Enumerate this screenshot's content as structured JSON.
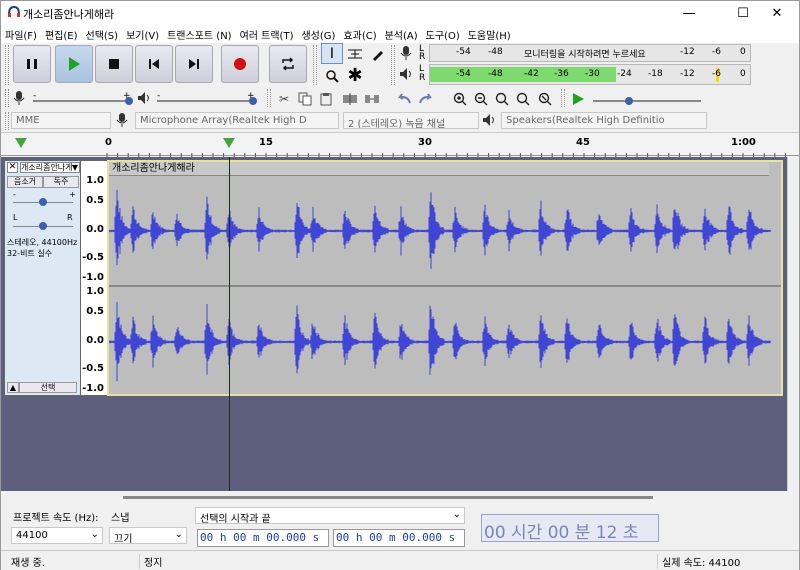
{
  "window": {
    "title": "개소리좀안나게해라",
    "minimize": "—",
    "maximize": "☐",
    "close": "✕"
  },
  "menu": [
    "파일(F)",
    "편집(E)",
    "선택(S)",
    "보기(V)",
    "트랜스포트 (N)",
    "여러 트랙(T)",
    "생성(G)",
    "효과(C)",
    "분석(A)",
    "도구(O)",
    "도움말(H)"
  ],
  "meters": {
    "record_ticks": [
      "-54",
      "-48",
      "모니터링을 시작하려면 누르세요",
      "-12",
      "-6",
      "0"
    ],
    "play_ticks": [
      "-54",
      "-48",
      "-42",
      "-36",
      "-30",
      "-24",
      "-18",
      "-12",
      "-6",
      "0"
    ],
    "channel_l": "L",
    "channel_r": "R",
    "play_level": 0.58
  },
  "devices": {
    "host": "MME",
    "input": "Microphone Array(Realtek High D",
    "channels": "2 (스테레오) 녹음 채널",
    "output": "Speakers(Realtek High Definitio"
  },
  "ruler": {
    "labels": [
      "0",
      "15",
      "30",
      "45",
      "1:00"
    ]
  },
  "track": {
    "name": "개소리좀안나게",
    "clip_name": "개소리좀안나게해라",
    "mute": "음소거",
    "solo": "독주",
    "gain_minus": "-",
    "gain_plus": "+",
    "pan_l": "L",
    "pan_r": "R",
    "info_line1": "스테레오, 44100Hz",
    "info_line2": "32-비트 실수",
    "select": "선택",
    "close": "✕",
    "collapse": "▲",
    "yticks": [
      "1.0",
      "0.5",
      "0.0",
      "-0.5",
      "-1.0"
    ]
  },
  "bottom": {
    "rate_label": "프로젝트 속도 (Hz):",
    "rate_value": "44100",
    "snap_label": "스냅",
    "snap_value": "끄기",
    "selection_label": "선택의 시작과 끝",
    "sel_start": "00 h 00 m 00.000 s",
    "sel_end": "00 h 00 m 00.000 s",
    "time_display": "00 시간 00 분 12 초"
  },
  "status": {
    "left": "재생 중.",
    "middle": "정지",
    "right": "실제 속도: 44100"
  }
}
